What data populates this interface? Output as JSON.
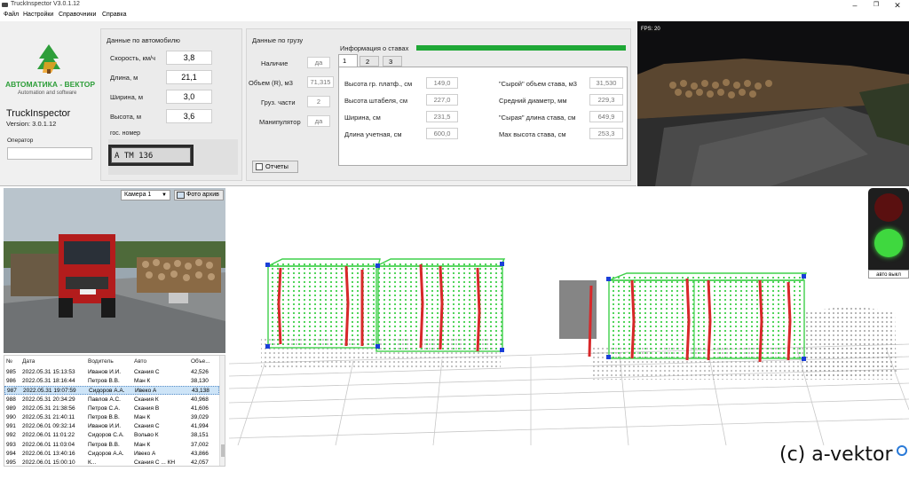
{
  "window": {
    "title": "TruckInspector V3.0.1.12",
    "buttons": {
      "minimize": "–",
      "maximize": "❐",
      "close": "✕"
    }
  },
  "menu": [
    "Файл",
    "Настройки",
    "Справочники",
    "Справка"
  ],
  "brand": {
    "company": "АВТОМАТИКА - ВЕКТОР",
    "tagline": "Automation and software",
    "product": "TruckInspector",
    "version": "Version: 3.0.1.12",
    "operator_label": "Оператор",
    "operator_value": ""
  },
  "vehicle": {
    "title": "Данные по автомобилю",
    "fields": [
      {
        "label": "Скорость, км/ч",
        "value": "3,8"
      },
      {
        "label": "Длина, м",
        "value": "21,1"
      },
      {
        "label": "Ширина, м",
        "value": "3,0"
      },
      {
        "label": "Высота, м",
        "value": "3,6"
      }
    ],
    "plate_label": "гос. номер",
    "plate_text": "А   ТМ 136"
  },
  "cargo": {
    "title": "Данные по грузу",
    "fields": [
      {
        "label": "Наличие",
        "value": "да"
      },
      {
        "label": "Объем (R), м3",
        "value": "71,315"
      },
      {
        "label": "Груз.  части",
        "value": "2"
      },
      {
        "label": "Манипулятор",
        "value": "да"
      }
    ],
    "reports_button": "Отчеты"
  },
  "stacks": {
    "title": "Информация о ставах",
    "tabs": [
      "1",
      "2",
      "3"
    ],
    "left": [
      {
        "label": "Высота гр. платф., см",
        "value": "149,0"
      },
      {
        "label": "Высота штабеля, см",
        "value": "227,0"
      },
      {
        "label": "Ширина, см",
        "value": "231,5"
      },
      {
        "label": "Длина учетная, см",
        "value": "600,0"
      }
    ],
    "right": [
      {
        "label": "\"Сырой\" объем става, м3",
        "value": "31,530"
      },
      {
        "label": "Средний диаметр, мм",
        "value": "229,3"
      },
      {
        "label": "\"Сырая\" длина става, см",
        "value": "649,9"
      },
      {
        "label": "Max высота става, см",
        "value": "253,3"
      }
    ]
  },
  "top_camera": {
    "fps": "FPS: 20"
  },
  "left_camera": {
    "select": "Камера 1",
    "archive_button": "Фото архив"
  },
  "table": {
    "headers": [
      "№",
      "Дата",
      "Водитель",
      "Авто",
      "Объе..."
    ],
    "rows": [
      [
        "985",
        "2022.05.31 15:13:53",
        "Иванов И.И.",
        "Скания С",
        "42,526"
      ],
      [
        "986",
        "2022.05.31 18:16:44",
        "Петров В.В.",
        "Ман К",
        "38,130"
      ],
      [
        "987",
        "2022.05.31 19:07:59",
        "Сидоров А.А.",
        "Ивеко А",
        "43,138"
      ],
      [
        "988",
        "2022.05.31 20:34:29",
        "Павлов А.С.",
        "Скания К",
        "40,968"
      ],
      [
        "989",
        "2022.05.31 21:38:56",
        "Петров С.А.",
        "Скания В",
        "41,606"
      ],
      [
        "990",
        "2022.05.31 21:40:11",
        "Петров В.В.",
        "Ман К",
        "39,029"
      ],
      [
        "991",
        "2022.06.01 09:32:14",
        "Иванов И.И.",
        "Скания С",
        "41,994"
      ],
      [
        "992",
        "2022.06.01 11:01:22",
        "Сидоров С.А.",
        "Вольво К",
        "38,151"
      ],
      [
        "993",
        "2022.06.01 11:03:04",
        "Петров В.В.",
        "Ман К",
        "37,002"
      ],
      [
        "994",
        "2022.06.01 13:40:16",
        "Сидоров А.А.",
        "Ивеко А",
        "43,866"
      ],
      [
        "995",
        "2022.06.01 15:00:10",
        "К...",
        "Скания С ... КН",
        "42,057"
      ]
    ],
    "selected_index": 2
  },
  "traffic_light": {
    "label": "авто выкл"
  },
  "watermark": "(c) a-vektor",
  "colors": {
    "accent_green": "#1fa836",
    "selected_row": "#cde4f7",
    "wire_green": "#3fd04a",
    "wire_red": "#d8282a",
    "node_blue": "#1a3fd8"
  }
}
